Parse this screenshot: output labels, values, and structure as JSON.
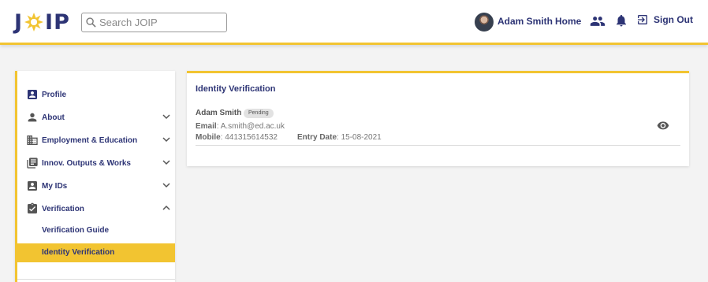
{
  "header": {
    "logo_text": "JOIP",
    "search_placeholder": "Search JOIP",
    "user_name": "Adam Smith",
    "home_label": "Home",
    "signout_label": "Sign Out"
  },
  "sidebar": {
    "items": [
      {
        "label": "Profile",
        "icon": "profile-icon"
      },
      {
        "label": "About",
        "icon": "person-icon",
        "expandable": true
      },
      {
        "label": "Employment & Education",
        "icon": "building-icon",
        "expandable": true
      },
      {
        "label": "Innov. Outputs & Works",
        "icon": "library-icon",
        "expandable": true
      },
      {
        "label": "My IDs",
        "icon": "id-card-icon",
        "expandable": true
      },
      {
        "label": "Verification",
        "icon": "clipboard-check-icon",
        "expanded": true
      }
    ],
    "sub_items": [
      {
        "label": "Verification Guide"
      },
      {
        "label": "Identity Verification",
        "active": true
      }
    ]
  },
  "card": {
    "title": "Identity Verification",
    "entry": {
      "name": "Adam Smith",
      "status": "Pending",
      "email_label": "Email",
      "email": "A.smith@ed.ac.uk",
      "mobile_label": "Mobile",
      "mobile": "441315614532",
      "entry_date_label": "Entry Date",
      "entry_date": "15-08-2021"
    }
  },
  "colors": {
    "brand_navy": "#2d3475",
    "accent_yellow": "#f2c431",
    "background": "#f3f3f3"
  }
}
